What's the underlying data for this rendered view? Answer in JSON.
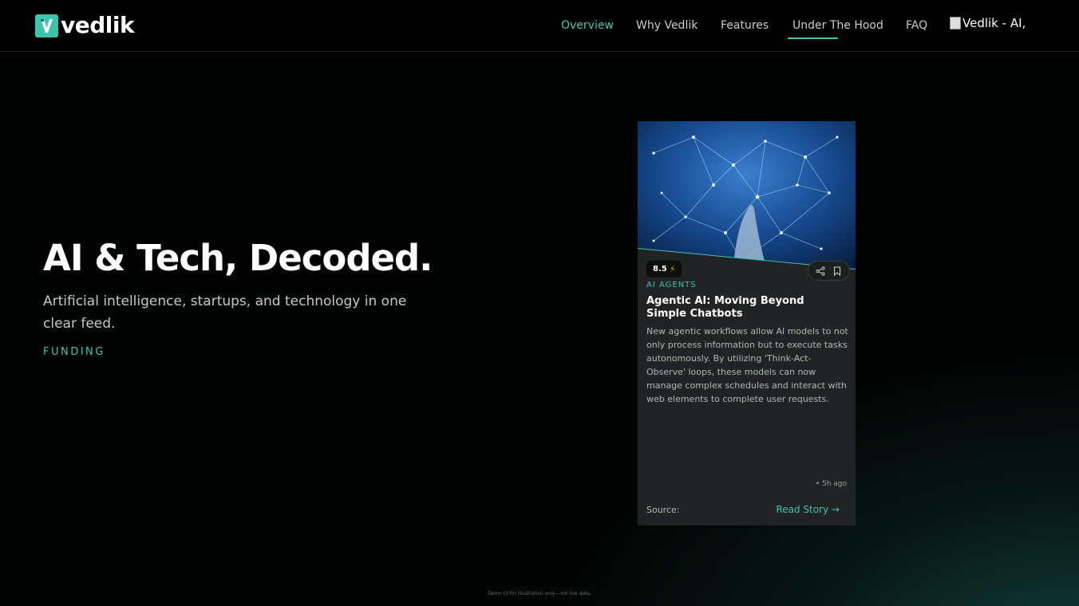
{
  "header": {
    "logo_text": "vedlik",
    "nav": {
      "overview": "Overview",
      "why": "Why Vedlik",
      "features": "Features",
      "under_the_hood": "Under The Hood",
      "faq": "FAQ"
    },
    "broken_image_alt": "Vedlik - AI,"
  },
  "hero": {
    "title": "AI & Tech, Decoded.",
    "subtitle": "Artificial intelligence, startups, and technology in one clear feed.",
    "tag": "FUNDING"
  },
  "card": {
    "score": "8.5",
    "category": "AI AGENTS",
    "title": "Agentic AI: Moving Beyond Simple Chatbots",
    "description": "New agentic workflows allow AI models to not only process information but to execute tasks autonomously. By utilizing 'Think-Act-Observe' loops, these models can now manage complex schedules and interact with web elements to complete user requests.",
    "time": "5h ago",
    "source_label": "Source:",
    "read_label": "Read Story →"
  },
  "footer_note": "Demo UI for illustration only—not live data.",
  "colors": {
    "accent": "#3cc4ad",
    "background": "#000000",
    "card": "#222324",
    "score_bolt": "#e09a3b"
  },
  "icons": {
    "logo": "v-logo-icon",
    "share": "share-icon",
    "bookmark": "bookmark-icon",
    "bolt": "lightning-icon"
  }
}
